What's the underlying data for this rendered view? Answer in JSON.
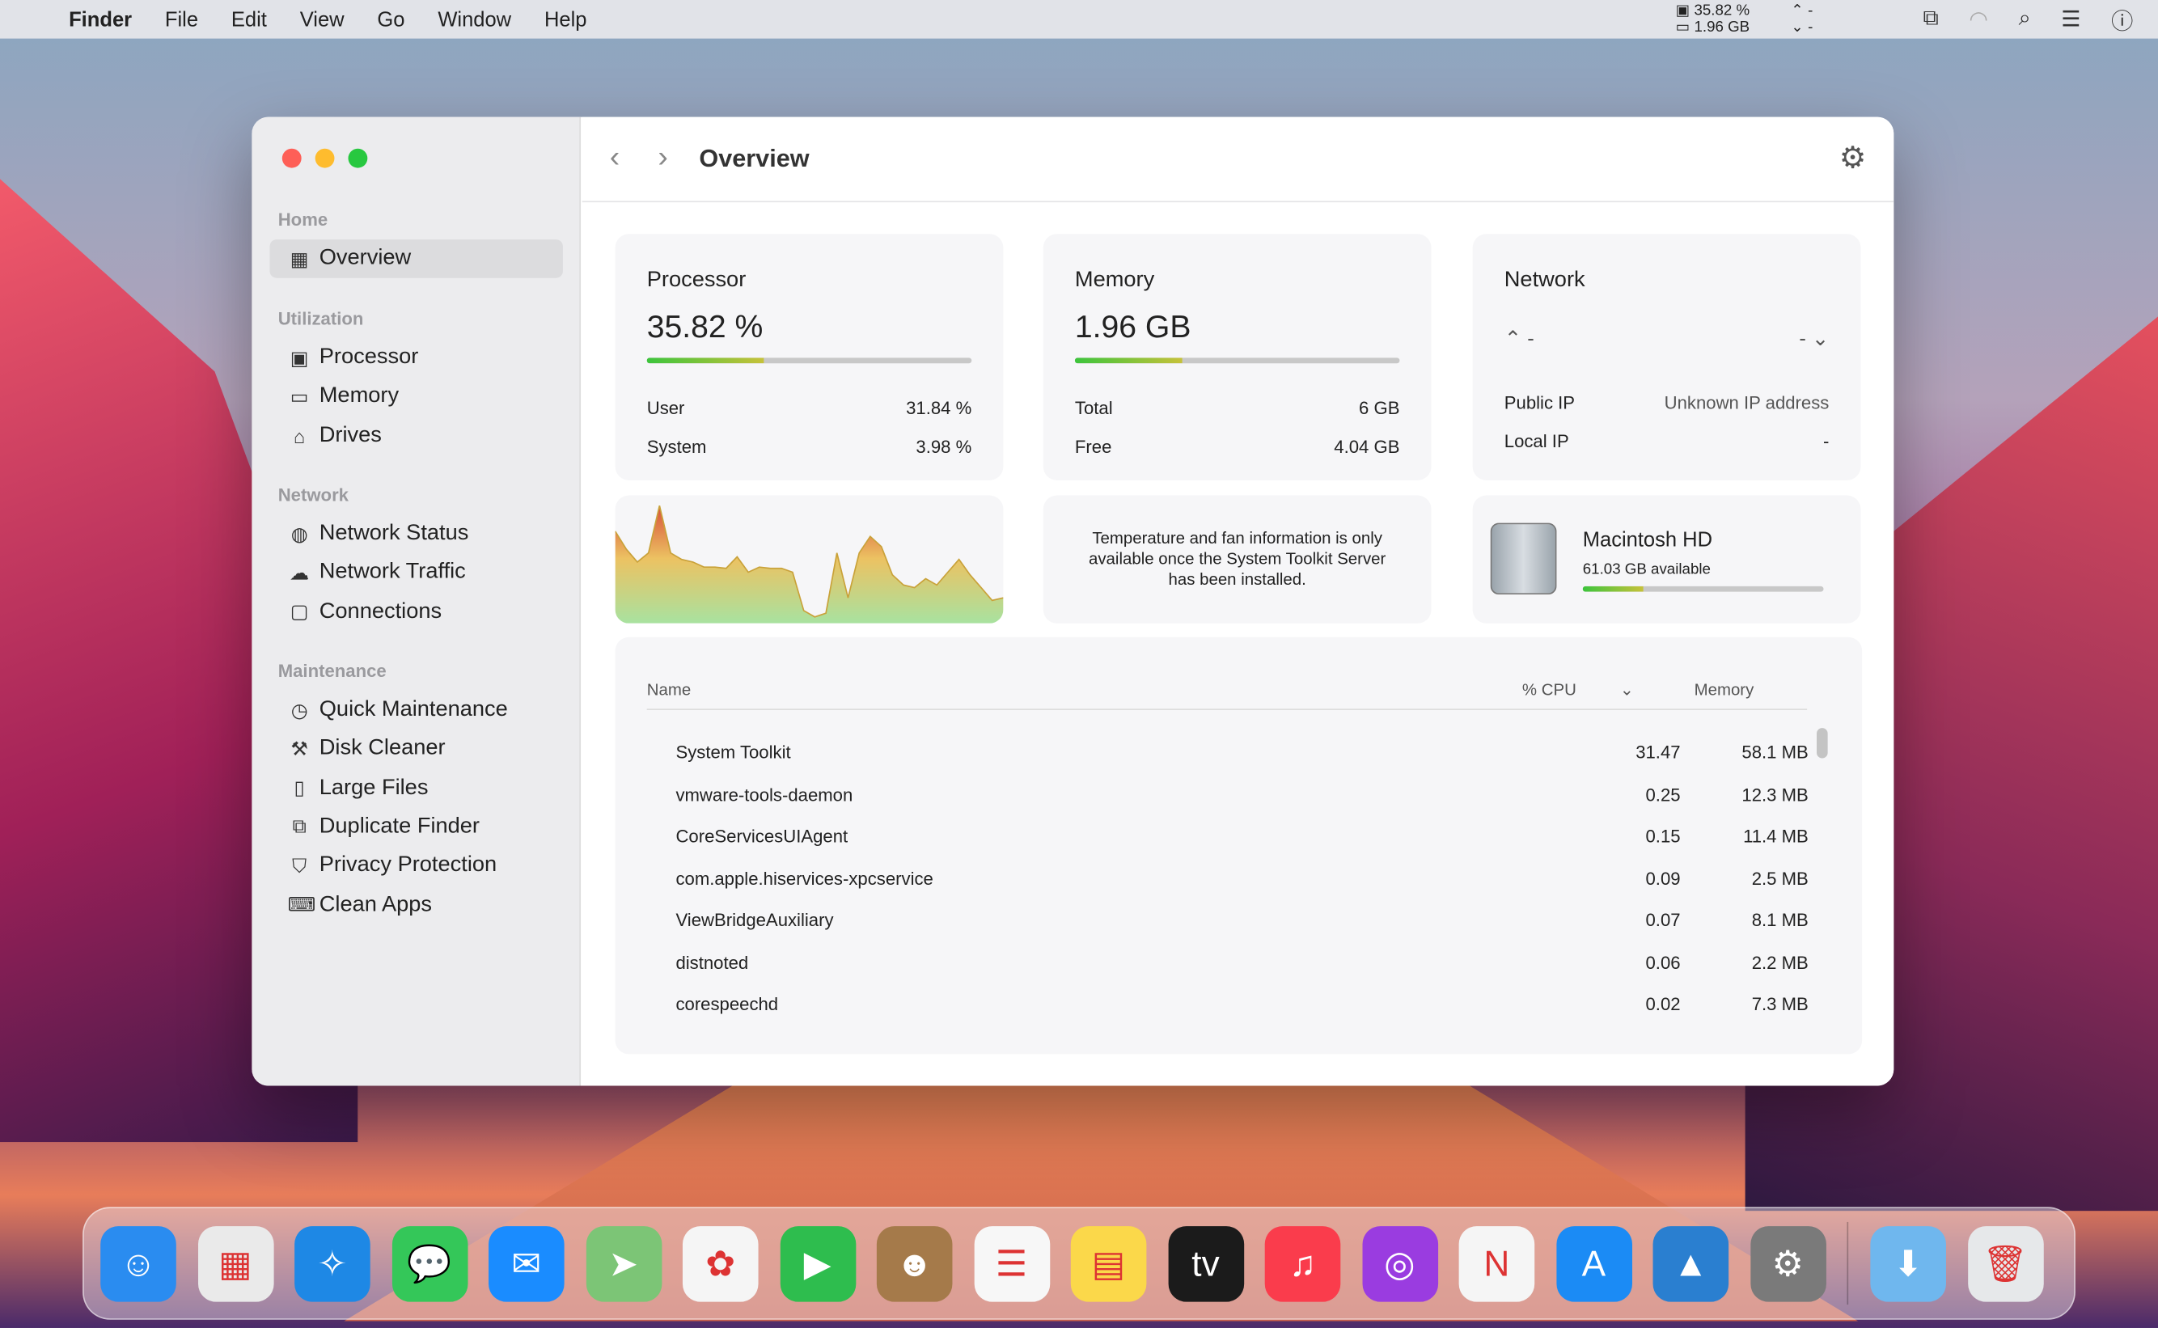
{
  "menubar": {
    "app": "Finder",
    "menus": [
      "File",
      "Edit",
      "View",
      "Go",
      "Window",
      "Help"
    ],
    "cpu": "35.82 %",
    "mem": "1.96 GB",
    "up": "-",
    "down": "-"
  },
  "sidebar": {
    "sections": [
      {
        "label": "Home",
        "items": [
          {
            "label": "Overview",
            "icon": "grid-icon"
          }
        ]
      },
      {
        "label": "Utilization",
        "items": [
          {
            "label": "Processor",
            "icon": "cpu-icon"
          },
          {
            "label": "Memory",
            "icon": "memory-icon"
          },
          {
            "label": "Drives",
            "icon": "drive-icon"
          }
        ]
      },
      {
        "label": "Network",
        "items": [
          {
            "label": "Network Status",
            "icon": "globe-icon"
          },
          {
            "label": "Network Traffic",
            "icon": "cloud-icon"
          },
          {
            "label": "Connections",
            "icon": "monitor-icon"
          }
        ]
      },
      {
        "label": "Maintenance",
        "items": [
          {
            "label": "Quick Maintenance",
            "icon": "timer-icon"
          },
          {
            "label": "Disk Cleaner",
            "icon": "broom-icon"
          },
          {
            "label": "Large Files",
            "icon": "files-icon"
          },
          {
            "label": "Duplicate Finder",
            "icon": "duplicate-icon"
          },
          {
            "label": "Privacy Protection",
            "icon": "shield-icon"
          },
          {
            "label": "Clean Apps",
            "icon": "keyboard-icon"
          }
        ]
      }
    ]
  },
  "header": {
    "title": "Overview"
  },
  "processor": {
    "title": "Processor",
    "value": "35.82 %",
    "percent": 35.82,
    "user_label": "User",
    "user": "31.84 %",
    "system_label": "System",
    "system": "3.98 %"
  },
  "memory": {
    "title": "Memory",
    "value": "1.96 GB",
    "percent": 33,
    "total_label": "Total",
    "total": "6 GB",
    "free_label": "Free",
    "free": "4.04 GB"
  },
  "network": {
    "title": "Network",
    "up": "-",
    "down": "-",
    "public_label": "Public IP",
    "public": "Unknown IP address",
    "local_label": "Local IP",
    "local": "-"
  },
  "cpu_history": [
    72,
    58,
    48,
    55,
    92,
    55,
    50,
    48,
    44,
    44,
    43,
    52,
    40,
    44,
    43,
    43,
    40,
    10,
    5,
    8,
    55,
    20,
    55,
    68,
    60,
    38,
    30,
    28,
    35,
    30,
    40,
    50,
    38,
    28,
    18,
    20
  ],
  "sensors": {
    "message": "Temperature and fan information is only available once the System Toolkit Server has been installed."
  },
  "disk": {
    "name": "Macintosh HD",
    "available": "61.03 GB available",
    "used_percent": 25
  },
  "processes": {
    "columns": {
      "name": "Name",
      "cpu": "% CPU",
      "memory": "Memory"
    },
    "rows": [
      {
        "name": "System Toolkit",
        "cpu": "31.47",
        "memory": "58.1 MB"
      },
      {
        "name": "vmware-tools-daemon",
        "cpu": "0.25",
        "memory": "12.3 MB"
      },
      {
        "name": "CoreServicesUIAgent",
        "cpu": "0.15",
        "memory": "11.4 MB"
      },
      {
        "name": "com.apple.hiservices-xpcservice",
        "cpu": "0.09",
        "memory": "2.5 MB"
      },
      {
        "name": "ViewBridgeAuxiliary",
        "cpu": "0.07",
        "memory": "8.1 MB"
      },
      {
        "name": "distnoted",
        "cpu": "0.06",
        "memory": "2.2 MB"
      },
      {
        "name": "corespeechd",
        "cpu": "0.02",
        "memory": "7.3 MB"
      }
    ]
  },
  "dock": [
    {
      "name": "finder",
      "glyph": "☺",
      "color": "#2a8cf0"
    },
    {
      "name": "launchpad",
      "glyph": "▦",
      "color": "#eaeaea"
    },
    {
      "name": "safari",
      "glyph": "✧",
      "color": "#1e88e5"
    },
    {
      "name": "messages",
      "glyph": "💬",
      "color": "#34c759"
    },
    {
      "name": "mail",
      "glyph": "✉",
      "color": "#1a8cff"
    },
    {
      "name": "maps",
      "glyph": "➤",
      "color": "#7cc576"
    },
    {
      "name": "photos",
      "glyph": "✿",
      "color": "#f5f5f5"
    },
    {
      "name": "facetime",
      "glyph": "▶",
      "color": "#2ebd4e"
    },
    {
      "name": "contacts",
      "glyph": "☻",
      "color": "#a57a4a"
    },
    {
      "name": "reminders",
      "glyph": "☰",
      "color": "#f7f7f7"
    },
    {
      "name": "notes",
      "glyph": "▤",
      "color": "#fbd84a"
    },
    {
      "name": "tv",
      "glyph": "tv",
      "color": "#1b1b1b"
    },
    {
      "name": "music",
      "glyph": "♫",
      "color": "#fa3c4c"
    },
    {
      "name": "podcasts",
      "glyph": "◎",
      "color": "#9a3ce0"
    },
    {
      "name": "news",
      "glyph": "N",
      "color": "#f5f5f5"
    },
    {
      "name": "app-store",
      "glyph": "A",
      "color": "#1b8bf5"
    },
    {
      "name": "system-toolkit",
      "glyph": "▲",
      "color": "#2a7fd0"
    },
    {
      "name": "system-preferences",
      "glyph": "⚙",
      "color": "#7a7a7a"
    },
    {
      "name": "downloads",
      "glyph": "⬇",
      "color": "#6fb7ee"
    },
    {
      "name": "trash",
      "glyph": "🗑",
      "color": "#e6e8ea"
    }
  ]
}
